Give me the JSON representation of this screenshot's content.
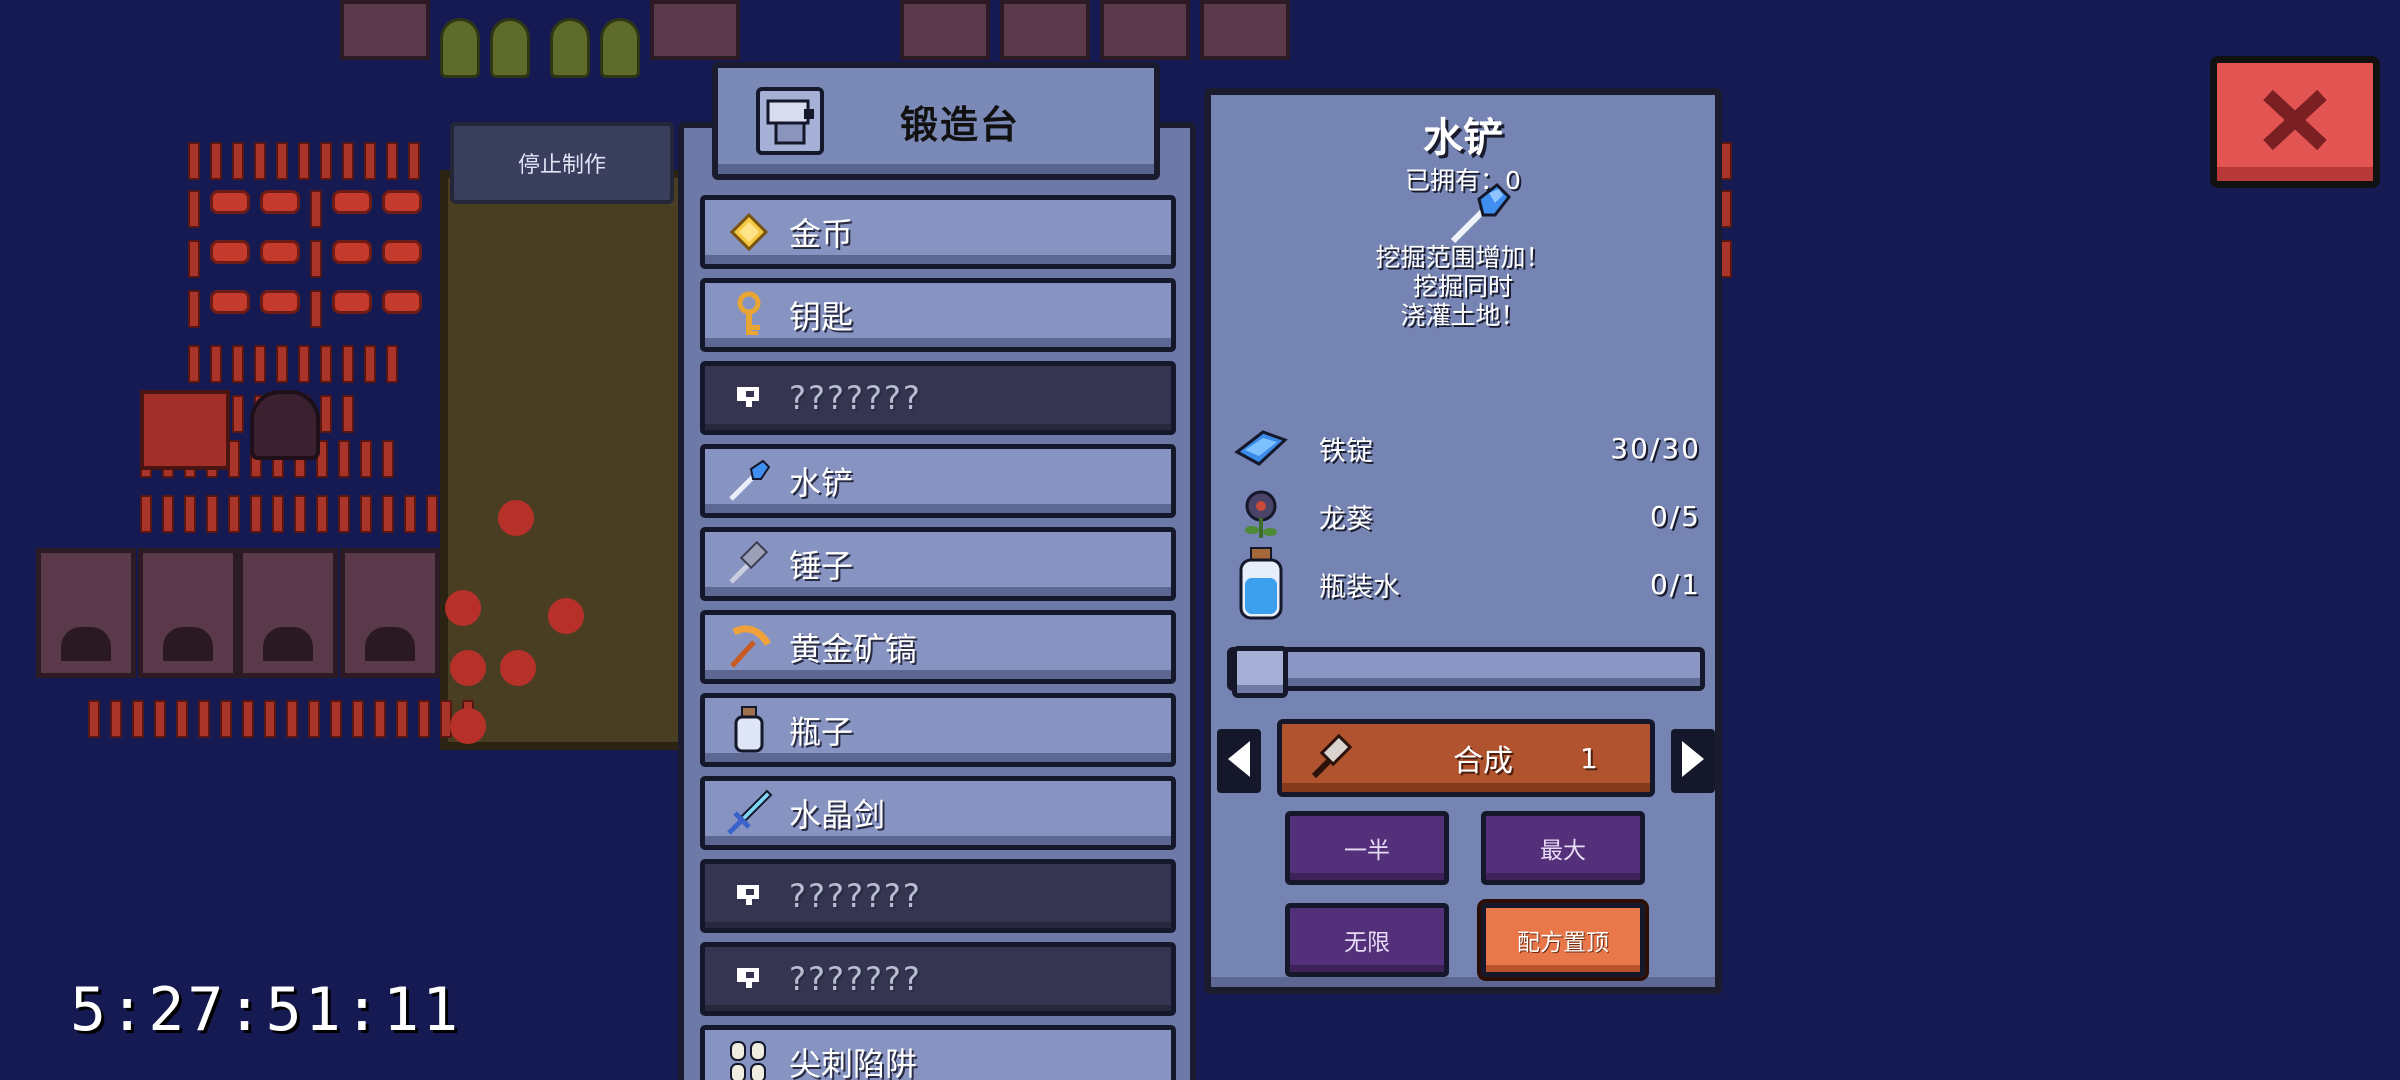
{
  "stop_button": {
    "label": "停止制作"
  },
  "station": {
    "title": "锻造台",
    "icon": "forge-icon"
  },
  "recipes": [
    {
      "label": "金币",
      "icon": "gold-coin-icon",
      "known": true
    },
    {
      "label": "钥匙",
      "icon": "key-icon",
      "known": true
    },
    {
      "label": "???????",
      "icon": "unknown-icon",
      "known": false
    },
    {
      "label": "水铲",
      "icon": "water-shovel-icon",
      "known": true
    },
    {
      "label": "锤子",
      "icon": "hammer-icon",
      "known": true
    },
    {
      "label": "黄金矿镐",
      "icon": "golden-pickaxe-icon",
      "known": true
    },
    {
      "label": "瓶子",
      "icon": "bottle-icon",
      "known": true
    },
    {
      "label": "水晶剑",
      "icon": "crystal-sword-icon",
      "known": true
    },
    {
      "label": "???????",
      "icon": "unknown-icon",
      "known": false
    },
    {
      "label": "???????",
      "icon": "unknown-icon",
      "known": false
    },
    {
      "label": "尖刺陷阱",
      "icon": "spike-trap-icon",
      "known": true
    }
  ],
  "detail": {
    "title": "水铲",
    "owned": "已拥有：0",
    "item_icon": "water-shovel-icon",
    "description": [
      "挖掘范围增加！",
      "挖掘同时",
      "浇灌土地！"
    ],
    "ingredients": [
      {
        "name": "铁锭",
        "count": "30/30",
        "icon": "iron-ingot-icon"
      },
      {
        "name": "龙葵",
        "count": "0/5",
        "icon": "nightshade-icon"
      },
      {
        "name": "瓶装水",
        "count": "0/1",
        "icon": "bottled-water-icon"
      }
    ],
    "quantity_slider": {
      "value": 1
    },
    "craft_button": {
      "label": "合成",
      "quantity": "1"
    },
    "options": {
      "half": "一半",
      "max": "最大",
      "infinite": "无限",
      "pin_recipe": "配方置顶"
    }
  },
  "close_button": {
    "icon": "close-icon"
  },
  "timer": "5:27:51:11",
  "colors": {
    "background": "#161a52",
    "panel": "#7584b2",
    "craft_button": "#b0532e",
    "option_button": "#55307a",
    "pin_button": "#e8784a",
    "close_button": "#e35553"
  }
}
